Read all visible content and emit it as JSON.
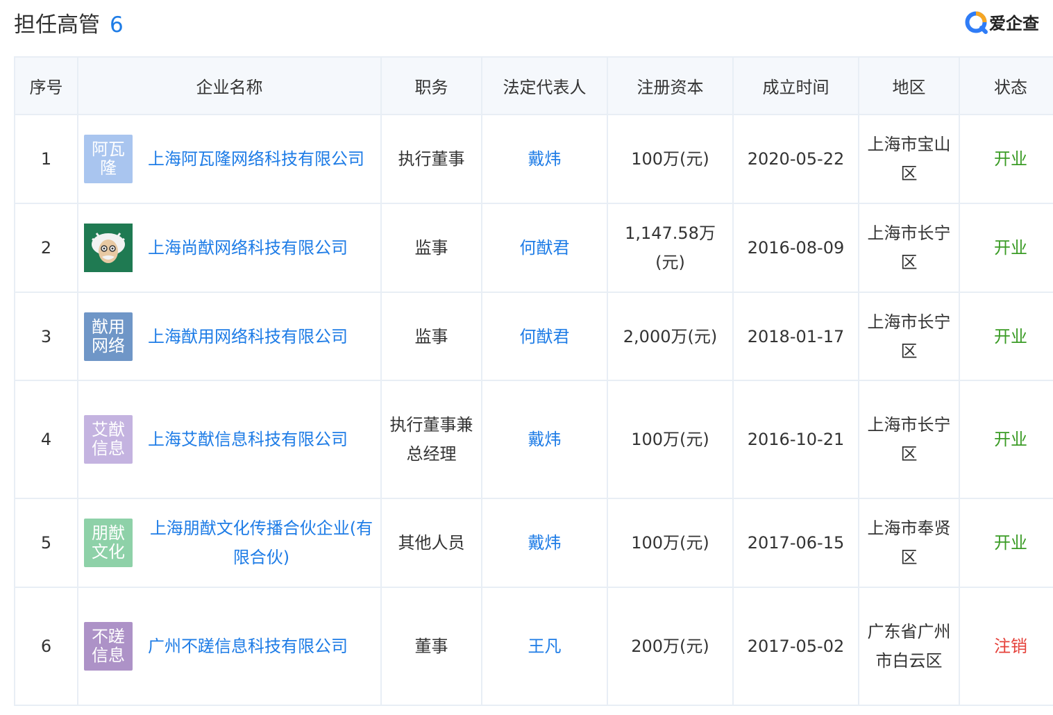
{
  "header": {
    "title": "担任高管",
    "count": "6",
    "brand_name": "爱企查",
    "brand_icon": "aiqicha-logo-icon"
  },
  "table": {
    "columns": [
      "序号",
      "企业名称",
      "职务",
      "法定代表人",
      "注册资本",
      "成立时间",
      "地区",
      "状态"
    ],
    "rows": [
      {
        "seq": "1",
        "logo_text": "阿瓦隆",
        "logo_color": "#a9c5ef",
        "company": "上海阿瓦隆网络科技有限公司",
        "role": "执行董事",
        "legal_rep": "戴炜",
        "capital": "100万(元)",
        "date": "2020-05-22",
        "area": "上海市宝山区",
        "status": "开业",
        "status_type": "open"
      },
      {
        "seq": "2",
        "logo_text": "",
        "logo_icon": "einstein-avatar-icon",
        "logo_color": "#1f7a52",
        "company": "上海尚猷网络科技有限公司",
        "role": "监事",
        "legal_rep": "何猷君",
        "capital": "1,147.58万(元)",
        "date": "2016-08-09",
        "area": "上海市长宁区",
        "status": "开业",
        "status_type": "open"
      },
      {
        "seq": "3",
        "logo_text": "猷用网络",
        "logo_color": "#6f96c7",
        "company": "上海猷用网络科技有限公司",
        "role": "监事",
        "legal_rep": "何猷君",
        "capital": "2,000万(元)",
        "date": "2018-01-17",
        "area": "上海市长宁区",
        "status": "开业",
        "status_type": "open"
      },
      {
        "seq": "4",
        "logo_text": "艾猷信息",
        "logo_color": "#c4b3e0",
        "company": "上海艾猷信息科技有限公司",
        "role": "执行董事兼总经理",
        "legal_rep": "戴炜",
        "capital": "100万(元)",
        "date": "2016-10-21",
        "area": "上海市长宁区",
        "status": "开业",
        "status_type": "open"
      },
      {
        "seq": "5",
        "logo_text": "朋猷文化",
        "logo_color": "#8ed1a8",
        "company": "上海朋猷文化传播合伙企业(有限合伙)",
        "role": "其他人员",
        "legal_rep": "戴炜",
        "capital": "100万(元)",
        "date": "2017-06-15",
        "area": "上海市奉贤区",
        "status": "开业",
        "status_type": "open"
      },
      {
        "seq": "6",
        "logo_text": "不蹉信息",
        "logo_color": "#ad92c7",
        "company": "广州不蹉信息科技有限公司",
        "role": "董事",
        "legal_rep": "王凡",
        "capital": "200万(元)",
        "date": "2017-05-02",
        "area": "广东省广州市白云区",
        "status": "注销",
        "status_type": "cancel"
      }
    ]
  },
  "colors": {
    "accent": "#1e7ce6",
    "status_open": "#3a9b25",
    "status_cancel": "#e5413a",
    "header_bg": "#f5f8fc",
    "border": "#e8eef5"
  }
}
